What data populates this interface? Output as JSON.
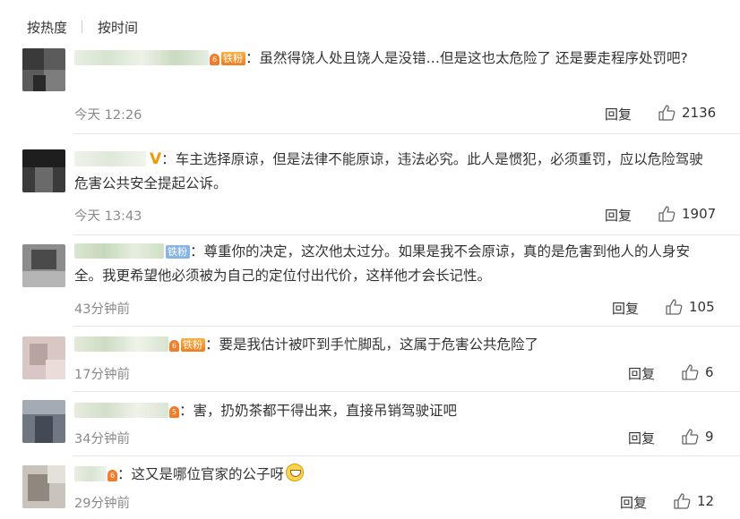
{
  "sort": {
    "hot": "按热度",
    "time": "按时间"
  },
  "reply_label": "回复",
  "comments": [
    {
      "badge": "铁粉",
      "text": "虽然得饶人处且饶人是没错…但是这也太危险了 还是要走程序处罚吧?",
      "time": "今天 12:26",
      "likes": "2136"
    },
    {
      "text": "车主选择原谅，但是法律不能原谅，违法必究。此人是惯犯，必须重罚，应以危险驾驶危害公共安全提起公诉。",
      "time": "今天 13:43",
      "likes": "1907"
    },
    {
      "badge": "铁粉",
      "text": "尊重你的决定，这次他太过分。如果是我不会原谅，真的是危害到他人的人身安全。我更希望他必须被为自己的定位付出代价，这样他才会长记性。",
      "time": "43分钟前",
      "likes": "105"
    },
    {
      "badge": "铁粉",
      "text": "要是我估计被吓到手忙脚乱，这属于危害公共危险了",
      "time": "17分钟前",
      "likes": "6"
    },
    {
      "text": "害，扔奶茶都干得出来，直接吊销驾驶证吧",
      "time": "34分钟前",
      "likes": "9"
    },
    {
      "text": "这又是哪位官家的公子呀",
      "time": "29分钟前",
      "likes": "12"
    }
  ]
}
